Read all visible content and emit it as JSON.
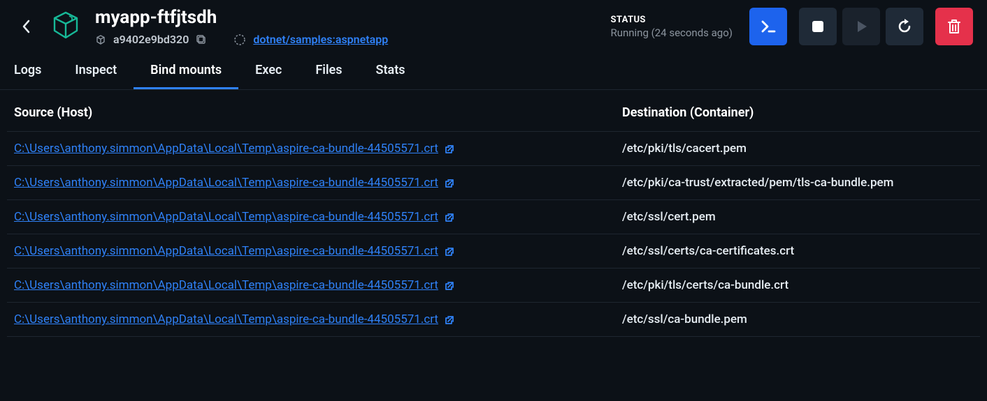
{
  "header": {
    "title": "myapp-ftfjtsdh",
    "hash": "a9402e9bd320",
    "image_link": "dotnet/samples:aspnetapp",
    "status_label": "STATUS",
    "status_value": "Running (24 seconds ago)"
  },
  "tabs": [
    {
      "label": "Logs",
      "active": false
    },
    {
      "label": "Inspect",
      "active": false
    },
    {
      "label": "Bind mounts",
      "active": true
    },
    {
      "label": "Exec",
      "active": false
    },
    {
      "label": "Files",
      "active": false
    },
    {
      "label": "Stats",
      "active": false
    }
  ],
  "table": {
    "headers": {
      "source": "Source (Host)",
      "destination": "Destination (Container)"
    },
    "rows": [
      {
        "source": "C:\\Users\\anthony.simmon\\AppData\\Local\\Temp\\aspire-ca-bundle-44505571.crt",
        "destination": "/etc/pki/tls/cacert.pem"
      },
      {
        "source": "C:\\Users\\anthony.simmon\\AppData\\Local\\Temp\\aspire-ca-bundle-44505571.crt",
        "destination": "/etc/pki/ca-trust/extracted/pem/tls-ca-bundle.pem"
      },
      {
        "source": "C:\\Users\\anthony.simmon\\AppData\\Local\\Temp\\aspire-ca-bundle-44505571.crt",
        "destination": "/etc/ssl/cert.pem"
      },
      {
        "source": "C:\\Users\\anthony.simmon\\AppData\\Local\\Temp\\aspire-ca-bundle-44505571.crt",
        "destination": "/etc/ssl/certs/ca-certificates.crt"
      },
      {
        "source": "C:\\Users\\anthony.simmon\\AppData\\Local\\Temp\\aspire-ca-bundle-44505571.crt",
        "destination": "/etc/pki/tls/certs/ca-bundle.crt"
      },
      {
        "source": "C:\\Users\\anthony.simmon\\AppData\\Local\\Temp\\aspire-ca-bundle-44505571.crt",
        "destination": "/etc/ssl/ca-bundle.pem"
      }
    ]
  }
}
